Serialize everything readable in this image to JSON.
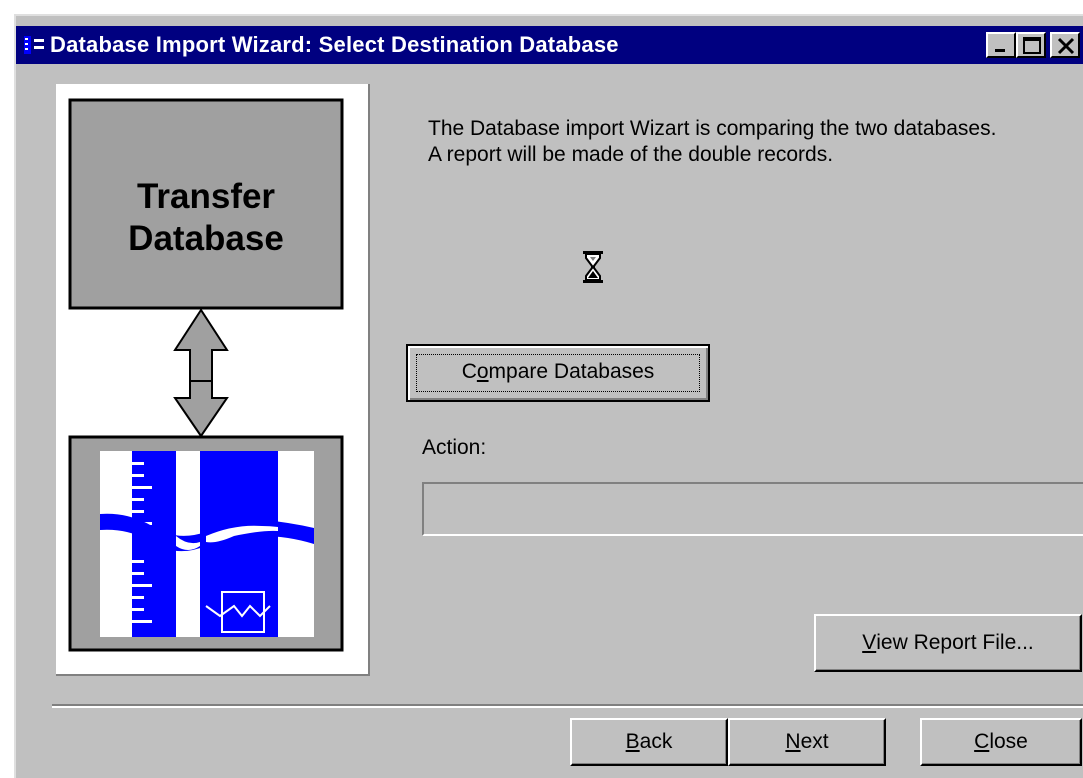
{
  "window": {
    "title": "Database Import Wizard: Select Destination Database",
    "controls": [
      "minimize-icon",
      "maximize-icon",
      "close-icon"
    ]
  },
  "illustration": {
    "title_line1": "Transfer",
    "title_line2": "Database"
  },
  "message": {
    "line1": "The Database import Wizart is comparing the two databases.",
    "line2": "A report will be made of the double records."
  },
  "compare_button": {
    "pre": "C",
    "accel": "o",
    "post": "mpare Databases"
  },
  "action": {
    "label": "Action:",
    "value": ""
  },
  "view_report_button": {
    "accel": "V",
    "post": "iew Report File..."
  },
  "nav": {
    "back": {
      "accel": "B",
      "post": "ack"
    },
    "next": {
      "accel": "N",
      "post": "ext"
    },
    "close": {
      "accel": "C",
      "post": "lose"
    }
  },
  "colors": {
    "titlebar": "#000080",
    "face": "#c0c0c0",
    "accent_blue": "#0000ff"
  }
}
